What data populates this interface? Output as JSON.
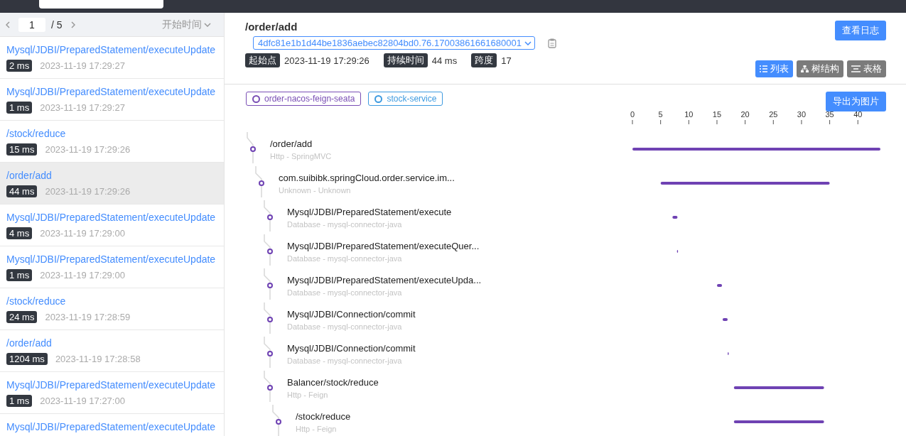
{
  "pager": {
    "page": "1",
    "total": "/ 5",
    "sort": "开始时间"
  },
  "traces": [
    {
      "name": "Mysql/JDBI/PreparedStatement/executeUpdate",
      "duration": "2 ms",
      "time": "2023-11-19 17:29:27",
      "selected": false
    },
    {
      "name": "Mysql/JDBI/PreparedStatement/executeUpdate",
      "duration": "1 ms",
      "time": "2023-11-19 17:29:27",
      "selected": false
    },
    {
      "name": "/stock/reduce",
      "duration": "15 ms",
      "time": "2023-11-19 17:29:26",
      "selected": false
    },
    {
      "name": "/order/add",
      "duration": "44 ms",
      "time": "2023-11-19 17:29:26",
      "selected": true
    },
    {
      "name": "Mysql/JDBI/PreparedStatement/executeUpdate",
      "duration": "4 ms",
      "time": "2023-11-19 17:29:00",
      "selected": false
    },
    {
      "name": "Mysql/JDBI/PreparedStatement/executeUpdate",
      "duration": "1 ms",
      "time": "2023-11-19 17:29:00",
      "selected": false
    },
    {
      "name": "/stock/reduce",
      "duration": "24 ms",
      "time": "2023-11-19 17:28:59",
      "selected": false
    },
    {
      "name": "/order/add",
      "duration": "1204 ms",
      "time": "2023-11-19 17:28:58",
      "selected": false
    },
    {
      "name": "Mysql/JDBI/PreparedStatement/executeUpdate",
      "duration": "1 ms",
      "time": "2023-11-19 17:27:00",
      "selected": false
    },
    {
      "name": "Mysql/JDBI/PreparedStatement/executeUpdate",
      "selected": false
    }
  ],
  "detail": {
    "title": "/order/add",
    "trace_id": "4dfc81e1b1d44be1836aebec82804bd0.76.17003861661680001",
    "log_button": "查看日志",
    "info": [
      {
        "label": "起始点",
        "value": "2023-11-19 17:29:26"
      },
      {
        "label": "持续时间",
        "value": "44 ms"
      },
      {
        "label": "跨度",
        "value": "17"
      }
    ],
    "view_buttons": [
      {
        "kind": "list",
        "label": "列表",
        "selected": true
      },
      {
        "kind": "tree",
        "label": "树结构",
        "selected": false
      },
      {
        "kind": "table",
        "label": "表格",
        "selected": false
      }
    ],
    "services": [
      {
        "name": "order-nacos-feign-seata",
        "color": "#7a4fb5"
      },
      {
        "name": "stock-service",
        "color": "#3e9be0"
      }
    ],
    "export_button": "导出为图片",
    "spans": [
      {
        "name": "/order/add",
        "type": "Http - SpringMVC",
        "children": [
          {
            "name": "com.suibibk.springCloud.order.service.im...",
            "type": "Unknown - Unknown",
            "children": [
              {
                "name": "Mysql/JDBI/PreparedStatement/execute",
                "type": "Database - mysql-connector-java"
              },
              {
                "name": "Mysql/JDBI/PreparedStatement/executeQuer...",
                "type": "Database - mysql-connector-java"
              },
              {
                "name": "Mysql/JDBI/PreparedStatement/executeUpda...",
                "type": "Database - mysql-connector-java"
              },
              {
                "name": "Mysql/JDBI/Connection/commit",
                "type": "Database - mysql-connector-java"
              },
              {
                "name": "Mysql/JDBI/Connection/commit",
                "type": "Database - mysql-connector-java"
              },
              {
                "name": "Balancer/stock/reduce",
                "type": "Http - Feign",
                "children": [
                  {
                    "name": "/stock/reduce",
                    "type": "Http - Feign"
                  }
                ]
              }
            ]
          }
        ]
      }
    ],
    "timeline": {
      "ticks": [
        "0",
        "5",
        "10",
        "15",
        "20",
        "25",
        "30",
        "35",
        "40"
      ]
    }
  }
}
